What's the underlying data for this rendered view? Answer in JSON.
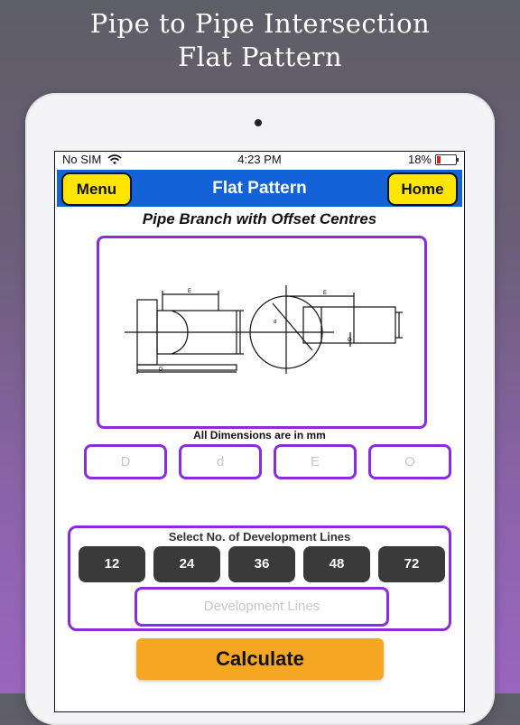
{
  "promo": {
    "line1": "Pipe to Pipe Intersection",
    "line2": "Flat Pattern"
  },
  "status": {
    "carrier": "No SIM",
    "time": "4:23 PM",
    "battery": "18%"
  },
  "nav": {
    "menu": "Menu",
    "title": "Flat Pattern",
    "home": "Home"
  },
  "page": {
    "subtitle": "Pipe Branch with Offset Centres",
    "note": "All Dimensions are in mm"
  },
  "diagram": {
    "labels": {
      "E": "E",
      "D": "D",
      "d": "d",
      "O": "O"
    }
  },
  "dimensions": {
    "D": "D",
    "d": "d",
    "E": "E",
    "O": "O"
  },
  "development": {
    "label": "Select No. of Development Lines",
    "options": [
      "12",
      "24",
      "36",
      "48",
      "72"
    ],
    "placeholder": "Development Lines"
  },
  "calculate": "Calculate",
  "colors": {
    "nav": "#1462d8",
    "button_yellow": "#ffe600",
    "accent_purple": "#8a2be2",
    "calculate": "#f5a623",
    "dev_button": "#3a3a3a"
  }
}
